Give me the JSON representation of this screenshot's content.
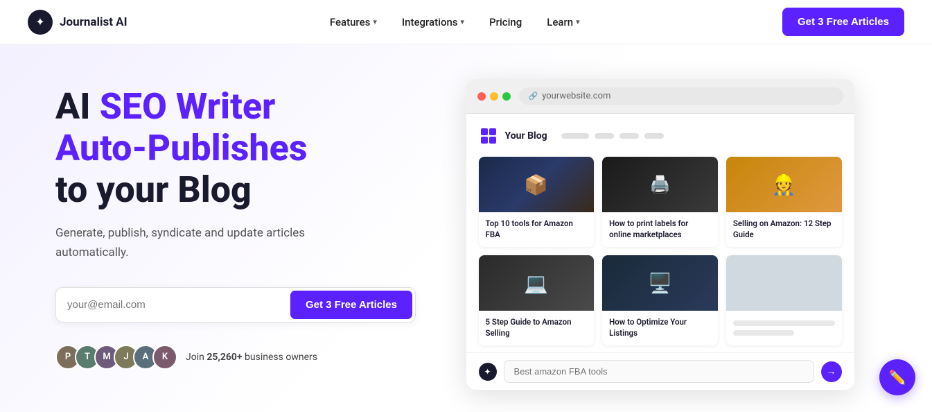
{
  "navbar": {
    "logo_text": "Journalist AI",
    "nav_items": [
      {
        "label": "Features",
        "has_chevron": true
      },
      {
        "label": "Integrations",
        "has_chevron": true
      },
      {
        "label": "Pricing",
        "has_chevron": false
      },
      {
        "label": "Learn",
        "has_chevron": true
      }
    ],
    "cta_label": "Get 3 Free Articles"
  },
  "hero": {
    "title_plain": "AI ",
    "title_purple": "SEO Writer",
    "title_rest": " that Auto-Publishes to your Blog",
    "subtitle": "Generate, publish, syndicate and update articles automatically.",
    "email_placeholder": "your@email.com",
    "cta_label": "Get 3 Free Articles",
    "social_proof": "Join ",
    "social_count": "25,260+",
    "social_suffix": " business owners"
  },
  "browser": {
    "url": "yourwebsite.com",
    "blog_name": "Your Blog",
    "cards": [
      {
        "img_type": "card-img-1",
        "title": "Top 10 tools for Amazon FBA"
      },
      {
        "img_type": "card-img-2",
        "title": "How to print labels for online marketplaces"
      },
      {
        "img_type": "card-img-3",
        "title": "Selling on Amazon: 12 Step Guide"
      },
      {
        "img_type": "card-img-4",
        "title": "5 Step Guide to Amazon Selling"
      },
      {
        "img_type": "card-img-5",
        "title": "How to Optimize Your Listings"
      },
      {
        "img_type": "card-img-placeholder",
        "title": ""
      }
    ],
    "search_placeholder": "Best amazon FBA tools"
  },
  "avatars": [
    {
      "color": "avatar-1",
      "initial": "P"
    },
    {
      "color": "avatar-2",
      "initial": "T"
    },
    {
      "color": "avatar-3",
      "initial": "M"
    },
    {
      "color": "avatar-4",
      "initial": "J"
    },
    {
      "color": "avatar-5",
      "initial": "A"
    },
    {
      "color": "avatar-6",
      "initial": "K"
    }
  ]
}
